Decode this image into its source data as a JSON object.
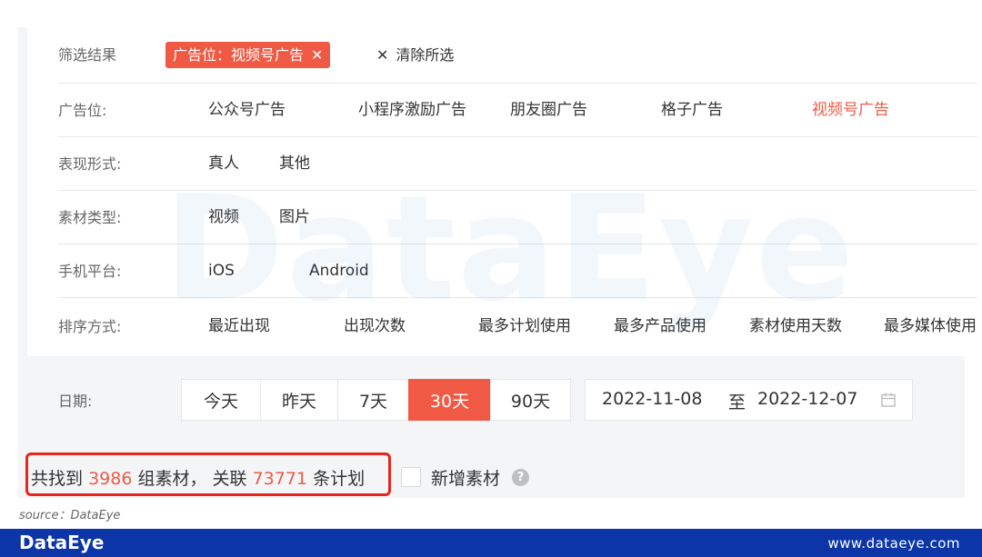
{
  "filters": {
    "result_label": "筛选结果",
    "selected_chip": "广告位：视频号广告",
    "clear_label": "清除所选",
    "rows": [
      {
        "label": "广告位:",
        "options": [
          "公众号广告",
          "小程序激励广告",
          "朋友圈广告",
          "格子广告",
          "视频号广告"
        ],
        "active": "视频号广告"
      },
      {
        "label": "表现形式:",
        "options": [
          "真人",
          "其他"
        ]
      },
      {
        "label": "素材类型:",
        "options": [
          "视频",
          "图片"
        ]
      },
      {
        "label": "手机平台:",
        "options": [
          "iOS",
          "Android"
        ]
      },
      {
        "label": "排序方式:",
        "options": [
          "最近出现",
          "出现次数",
          "最多计划使用",
          "最多产品使用",
          "素材使用天数",
          "最多媒体使用"
        ]
      }
    ]
  },
  "date": {
    "label": "日期:",
    "presets": [
      "今天",
      "昨天",
      "7天",
      "30天",
      "90天"
    ],
    "active_preset": "30天",
    "start": "2022-11-08",
    "separator": "至",
    "end": "2022-12-07"
  },
  "stats": {
    "prefix": "共找到",
    "groups": "3986",
    "middle": "组素材，  关联",
    "plans": "73771",
    "suffix": "条计划",
    "new_material_label": "新增素材",
    "help_glyph": "?"
  },
  "watermark": "DataEye",
  "source_text": "source：DataEye",
  "footer": {
    "brand": "DataEye",
    "site": "www.dataeye.com"
  },
  "colors": {
    "accent": "#f05a45",
    "highlight_box": "#e8251f",
    "footer_bg": "#0c35a8"
  },
  "icons": {
    "close": "close-icon",
    "calendar": "calendar-icon",
    "help": "help-icon"
  }
}
